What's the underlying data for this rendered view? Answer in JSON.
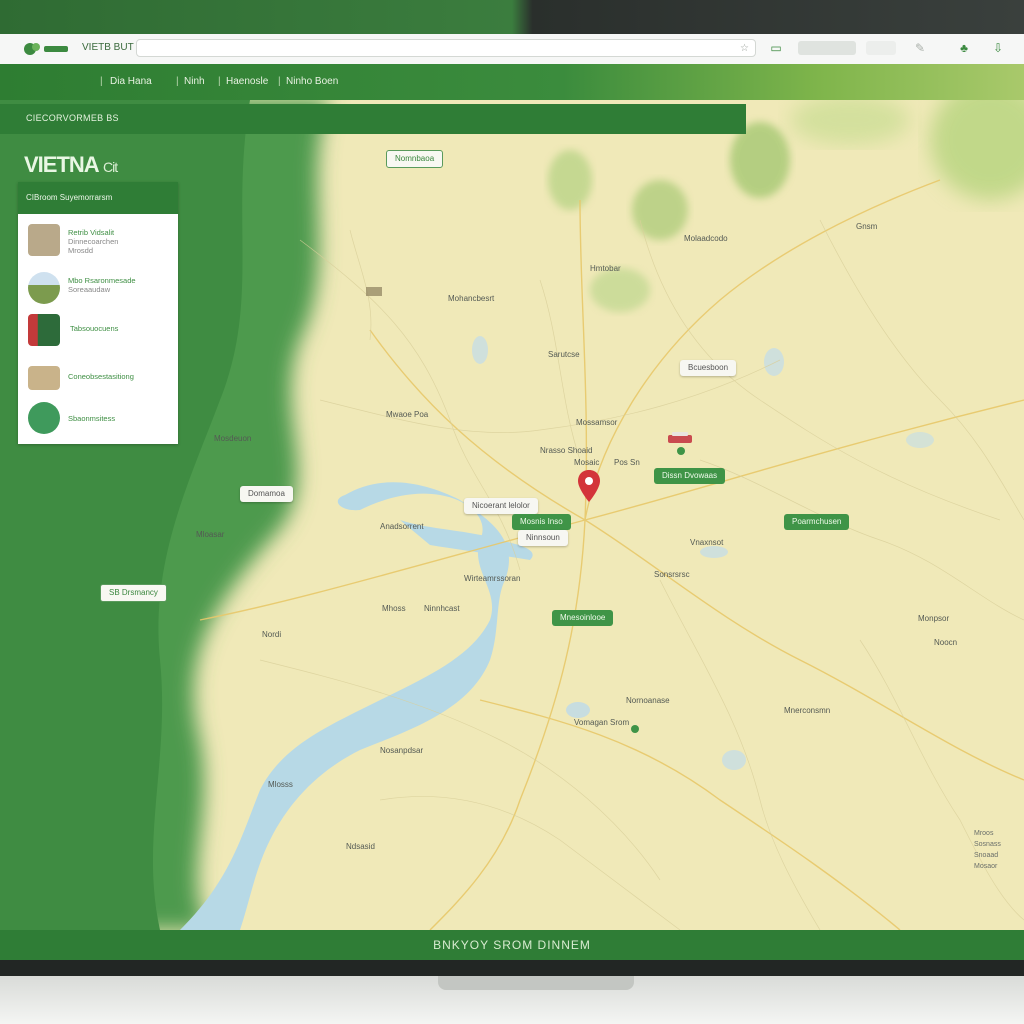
{
  "browser": {
    "site_label": "VIETB BUT",
    "url_text": "",
    "buttons": [
      "",
      ""
    ]
  },
  "nav": {
    "items": [
      "Dia Hana",
      "Ninh",
      "Haenosle",
      "Ninho Boen"
    ]
  },
  "page": {
    "strip_text": "CIECORVORMEB BS",
    "title": "VIETNA",
    "title_suffix": "Cit"
  },
  "sidebar": {
    "header": "CIBroom Suyemorrarsm",
    "items": [
      {
        "title": "Retrib Vidsalit",
        "sub": "Dinnecoarchen",
        "meta": "Mrosdd"
      },
      {
        "title": "Mbo Rsaronmesade",
        "sub": "Soreaaudaw",
        "meta": ""
      },
      {
        "title": "Tabsouocuens",
        "sub": "",
        "meta": ""
      },
      {
        "title": "Coneobsestasitiong",
        "sub": "",
        "meta": ""
      },
      {
        "title": "Sbaonmsitess",
        "sub": "",
        "meta": ""
      }
    ]
  },
  "map": {
    "labels": [
      {
        "text": "Mwaoe Poa",
        "kind": "plain"
      },
      {
        "text": "Mosaic",
        "kind": "plain"
      },
      {
        "text": "Nrasso Shoaid",
        "kind": "plain"
      },
      {
        "text": "Pos Sn",
        "kind": "plain"
      },
      {
        "text": "Mossamsor",
        "kind": "plain"
      },
      {
        "text": "Mosdeuon",
        "kind": "plain"
      },
      {
        "text": "Anadsorrent",
        "kind": "plain"
      },
      {
        "text": "Molaadcodo",
        "kind": "plain"
      },
      {
        "text": "Hmtobar",
        "kind": "plain"
      },
      {
        "text": "Sarutcse",
        "kind": "plain"
      },
      {
        "text": "Mohancbesrt",
        "kind": "plain"
      },
      {
        "text": "Wirteamrssoran",
        "kind": "plain"
      },
      {
        "text": "Mhoss",
        "kind": "plain"
      },
      {
        "text": "Ninnhcast",
        "kind": "plain"
      },
      {
        "text": "Nordi",
        "kind": "plain"
      },
      {
        "text": "Vomagan Srom",
        "kind": "plain"
      },
      {
        "text": "Nosanpdsar",
        "kind": "plain"
      },
      {
        "text": "Mlosss",
        "kind": "plain"
      },
      {
        "text": "Ndsasid",
        "kind": "plain"
      },
      {
        "text": "Nornoanase",
        "kind": "plain"
      },
      {
        "text": "Sonsrsrsc",
        "kind": "plain"
      },
      {
        "text": "Vnaxnsot",
        "kind": "plain"
      },
      {
        "text": "Monpsor",
        "kind": "plain"
      },
      {
        "text": "Gnsm",
        "kind": "plain"
      },
      {
        "text": "Mloasar",
        "kind": "plain"
      },
      {
        "text": "Noocn",
        "kind": "plain"
      },
      {
        "text": "Mnerconsmn",
        "kind": "plain"
      }
    ],
    "pills": [
      {
        "text": "Nomnbaoa",
        "kind": "outline"
      },
      {
        "text": "Dissn Dvowaas",
        "kind": "green"
      },
      {
        "text": "Poarmchusen",
        "kind": "green"
      },
      {
        "text": "Nicoerant lelolor",
        "kind": "white"
      },
      {
        "text": "Mosnis Inso",
        "kind": "green"
      },
      {
        "text": "Ninnsoun",
        "kind": "white"
      },
      {
        "text": "Mnesoinlooe",
        "kind": "green"
      },
      {
        "text": "SB Drsmancy",
        "kind": "outline"
      },
      {
        "text": "Domamoa",
        "kind": "white"
      },
      {
        "text": "Bcuesboon",
        "kind": "white"
      }
    ],
    "legend": [
      "Mroos",
      "Sosnass",
      "Snoaad",
      "Mosaor"
    ]
  },
  "footer": {
    "text": "BNKYOY SROM DINNEM"
  },
  "colors": {
    "primary_green": "#2f7d36",
    "accent_green": "#3f9447",
    "map_land": "#efe8b6",
    "water": "#b6d8e6",
    "pin_red": "#d3343a"
  }
}
